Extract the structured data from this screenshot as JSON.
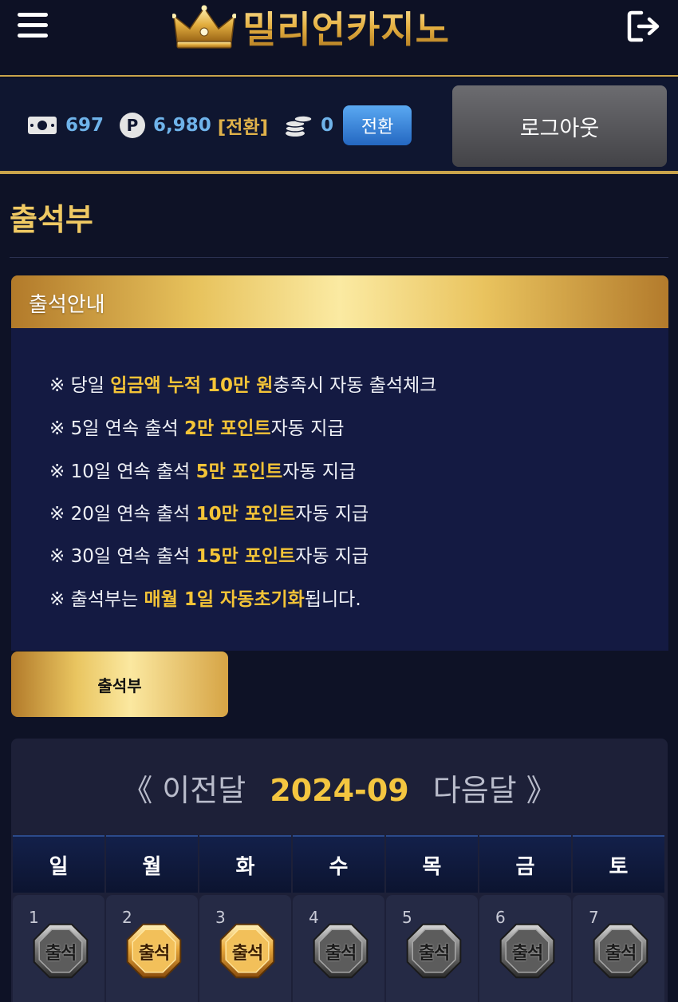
{
  "header": {
    "brand": "밀리언카지노"
  },
  "wallet": {
    "cash": "697",
    "points": "6,980",
    "points_convert": "[전환]",
    "coins": "0",
    "convert_button": "전환",
    "logout_button": "로그아웃",
    "point_badge": "P"
  },
  "page": {
    "title": "출석부"
  },
  "info": {
    "heading": "출석안내",
    "lines": [
      {
        "prefix": "※ 당일 ",
        "highlight": "입금액 누적 10만 원",
        "suffix": "충족시 자동 출석체크"
      },
      {
        "prefix": "※ 5일 연속 출석 ",
        "highlight": "2만 포인트",
        "suffix": "자동 지급"
      },
      {
        "prefix": "※ 10일 연속 출석 ",
        "highlight": "5만 포인트",
        "suffix": "자동 지급"
      },
      {
        "prefix": "※ 20일 연속 출석 ",
        "highlight": "10만 포인트",
        "suffix": "자동 지급"
      },
      {
        "prefix": "※ 30일 연속 출석 ",
        "highlight": "15만 포인트",
        "suffix": "자동 지급"
      },
      {
        "prefix": "※ 출석부는 ",
        "highlight": "매월 1일 자동초기화",
        "suffix": "됩니다."
      }
    ]
  },
  "tab": {
    "label": "출석부"
  },
  "calendar": {
    "prev": "《 이전달",
    "month": "2024-09",
    "next": "다음달 》",
    "weekdays": [
      "일",
      "월",
      "화",
      "수",
      "목",
      "금",
      "토"
    ],
    "days": [
      {
        "num": "1",
        "status": "missed",
        "stamp": "출석"
      },
      {
        "num": "2",
        "status": "attended",
        "stamp": "출석"
      },
      {
        "num": "3",
        "status": "attended",
        "stamp": "출석"
      },
      {
        "num": "4",
        "status": "missed",
        "stamp": "출석"
      },
      {
        "num": "5",
        "status": "missed",
        "stamp": "출석"
      },
      {
        "num": "6",
        "status": "missed",
        "stamp": "출석"
      },
      {
        "num": "7",
        "status": "missed",
        "stamp": "출석"
      }
    ]
  },
  "colors": {
    "gold": "#e0b24a",
    "highlight": "#f4c437",
    "blue_value": "#6fb3ea",
    "background": "#0e1226"
  }
}
